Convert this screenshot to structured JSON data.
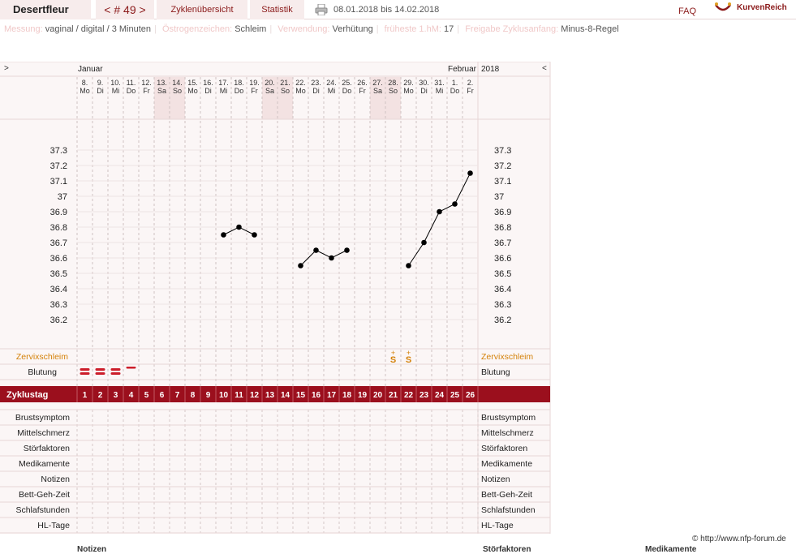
{
  "header": {
    "user": "Desertfleur",
    "cycle_nr": "< # 49 >",
    "tab_overview": "Zyklenübersicht",
    "tab_statistics": "Statistik",
    "date_range": "08.01.2018 bis 14.02.2018",
    "faq": "FAQ",
    "logo_text": "KurvenReich",
    "icons": [
      "print-icon",
      "logo-icon"
    ]
  },
  "info": {
    "messung_label": "Messung:",
    "messung_value": "vaginal / digital / 3 Minuten",
    "oestrogen_label": "Östrogenzeichen:",
    "oestrogen_value": "Schleim",
    "verwendung_label": "Verwendung:",
    "verwendung_value": "Verhütung",
    "hm_label": "früheste 1.hM:",
    "hm_value": "17",
    "freigabe_label": "Freigabe Zyklusanfang:",
    "freigabe_value": "Minus-8-Regel"
  },
  "chart_nav": {
    "prev": ">",
    "next": "<"
  },
  "months": {
    "left": "Januar",
    "right_month": "Februar",
    "right_year": "2018"
  },
  "days": [
    {
      "date": "8.",
      "wd": "Mo"
    },
    {
      "date": "9.",
      "wd": "Di"
    },
    {
      "date": "10.",
      "wd": "Mi"
    },
    {
      "date": "11.",
      "wd": "Do"
    },
    {
      "date": "12.",
      "wd": "Fr"
    },
    {
      "date": "13.",
      "wd": "Sa"
    },
    {
      "date": "14.",
      "wd": "So"
    },
    {
      "date": "15.",
      "wd": "Mo"
    },
    {
      "date": "16.",
      "wd": "Di"
    },
    {
      "date": "17.",
      "wd": "Mi"
    },
    {
      "date": "18.",
      "wd": "Do"
    },
    {
      "date": "19.",
      "wd": "Fr"
    },
    {
      "date": "20.",
      "wd": "Sa"
    },
    {
      "date": "21.",
      "wd": "So"
    },
    {
      "date": "22.",
      "wd": "Mo"
    },
    {
      "date": "23.",
      "wd": "Di"
    },
    {
      "date": "24.",
      "wd": "Mi"
    },
    {
      "date": "25.",
      "wd": "Do"
    },
    {
      "date": "26.",
      "wd": "Fr"
    },
    {
      "date": "27.",
      "wd": "Sa"
    },
    {
      "date": "28.",
      "wd": "So"
    },
    {
      "date": "29.",
      "wd": "Mo"
    },
    {
      "date": "30.",
      "wd": "Di"
    },
    {
      "date": "31.",
      "wd": "Mi"
    },
    {
      "date": "1.",
      "wd": "Do"
    },
    {
      "date": "2.",
      "wd": "Fr"
    }
  ],
  "weekend_indices": [
    5,
    6,
    12,
    13,
    19,
    20
  ],
  "temp_ticks": [
    "37.3",
    "37.2",
    "37.1",
    "37",
    "36.9",
    "36.8",
    "36.7",
    "36.6",
    "36.5",
    "36.4",
    "36.3",
    "36.2"
  ],
  "chart_data": {
    "type": "line",
    "x": [
      1,
      2,
      3,
      4,
      5,
      6,
      7,
      8,
      9,
      10,
      11,
      12,
      13,
      14,
      15,
      16,
      17,
      18,
      19,
      20,
      21,
      22,
      23,
      24,
      25,
      26
    ],
    "y": [
      null,
      null,
      null,
      null,
      null,
      null,
      null,
      null,
      null,
      36.75,
      36.8,
      36.75,
      null,
      null,
      36.55,
      36.65,
      36.6,
      36.65,
      null,
      null,
      null,
      36.55,
      36.7,
      36.9,
      36.95,
      37.15
    ],
    "ylim": [
      36.1,
      37.4
    ],
    "line_color": "#000000"
  },
  "labels": {
    "zervix": "Zervixschleim",
    "blutung": "Blutung",
    "zyklustag": "Zyklustag"
  },
  "zervix_marks": [
    {
      "cycle_day": 21,
      "symbol": "S",
      "mark": "+"
    },
    {
      "cycle_day": 22,
      "symbol": "S",
      "mark": "+"
    }
  ],
  "bleeding": [
    {
      "cycle_day": 1,
      "level": 2
    },
    {
      "cycle_day": 2,
      "level": 2
    },
    {
      "cycle_day": 3,
      "level": 2
    },
    {
      "cycle_day": 4,
      "level": 1
    }
  ],
  "cycle_days": [
    "1",
    "2",
    "3",
    "4",
    "5",
    "6",
    "7",
    "8",
    "9",
    "10",
    "11",
    "12",
    "13",
    "14",
    "15",
    "16",
    "17",
    "18",
    "19",
    "20",
    "21",
    "22",
    "23",
    "24",
    "25",
    "26"
  ],
  "bottom_rows": [
    "Brustsymptom",
    "Mittelschmerz",
    "Störfaktoren",
    "Medikamente",
    "Notizen",
    "Bett-Geh-Zeit",
    "Schlafstunden",
    "HL-Tage"
  ],
  "copyright": "© http://www.nfp-forum.de",
  "footer": {
    "notizen": "Notizen",
    "stoerfaktoren": "Störfaktoren",
    "medikamente": "Medikamente"
  },
  "colors": {
    "accent": "#9b0f1d",
    "weekend": "#f3e2e2",
    "zervix": "#d4820a",
    "blood": "#cc1d2a",
    "panel_bg": "#fbf6f6",
    "grid": "#e7d6d6"
  }
}
